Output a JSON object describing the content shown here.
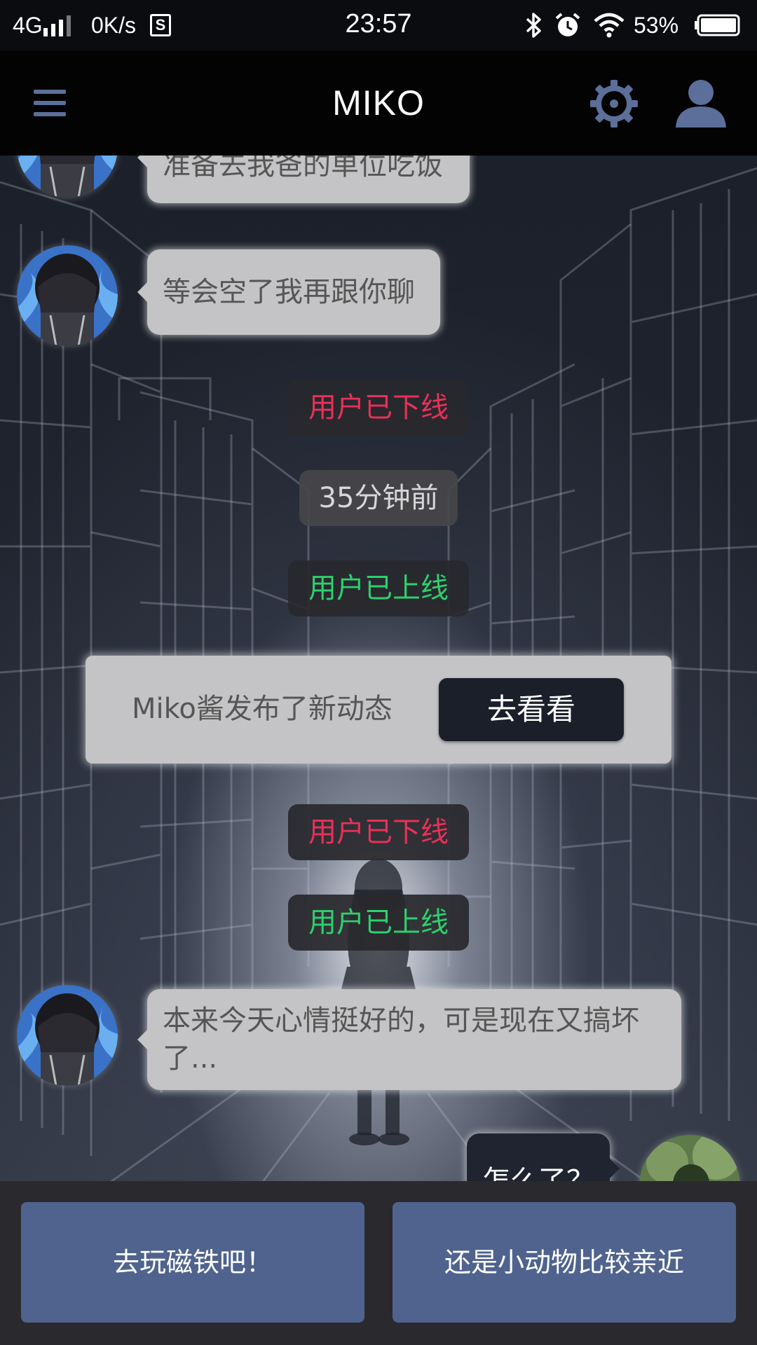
{
  "status_bar": {
    "network": "4G",
    "speed": "0K/s",
    "s_icon_text": "S",
    "time": "23:57",
    "battery": "53%",
    "icons": [
      "signal-icon",
      "s-app-icon",
      "bluetooth-icon",
      "alarm-icon",
      "wifi-icon",
      "battery-icon"
    ]
  },
  "header": {
    "title": "MIKO",
    "icons": [
      "menu-icon",
      "gear-icon",
      "user-icon"
    ],
    "icon_color": "#5b6f9a"
  },
  "messages": [
    {
      "type": "incoming",
      "text": "准备去我爸的单位吃饭"
    },
    {
      "type": "incoming",
      "text": "等会空了我再跟你聊"
    },
    {
      "type": "status",
      "kind": "offline",
      "text": "用户已下线"
    },
    {
      "type": "time",
      "text": "35分钟前"
    },
    {
      "type": "status",
      "kind": "online",
      "text": "用户已上线"
    },
    {
      "type": "post",
      "text": "Miko酱发布了新动态",
      "button": "去看看"
    },
    {
      "type": "status",
      "kind": "offline",
      "text": "用户已下线"
    },
    {
      "type": "status",
      "kind": "online",
      "text": "用户已上线"
    },
    {
      "type": "incoming",
      "text": "本来今天心情挺好的，可是现在又搞坏了..."
    },
    {
      "type": "outgoing",
      "text": "怎么了？"
    }
  ],
  "replies": [
    "去玩磁铁吧！",
    "还是小动物比较亲近"
  ],
  "colors": {
    "offline": "#e8315a",
    "online": "#2dd06e",
    "reply_button": "#4f638e",
    "bubble": "#c4c4c6"
  }
}
